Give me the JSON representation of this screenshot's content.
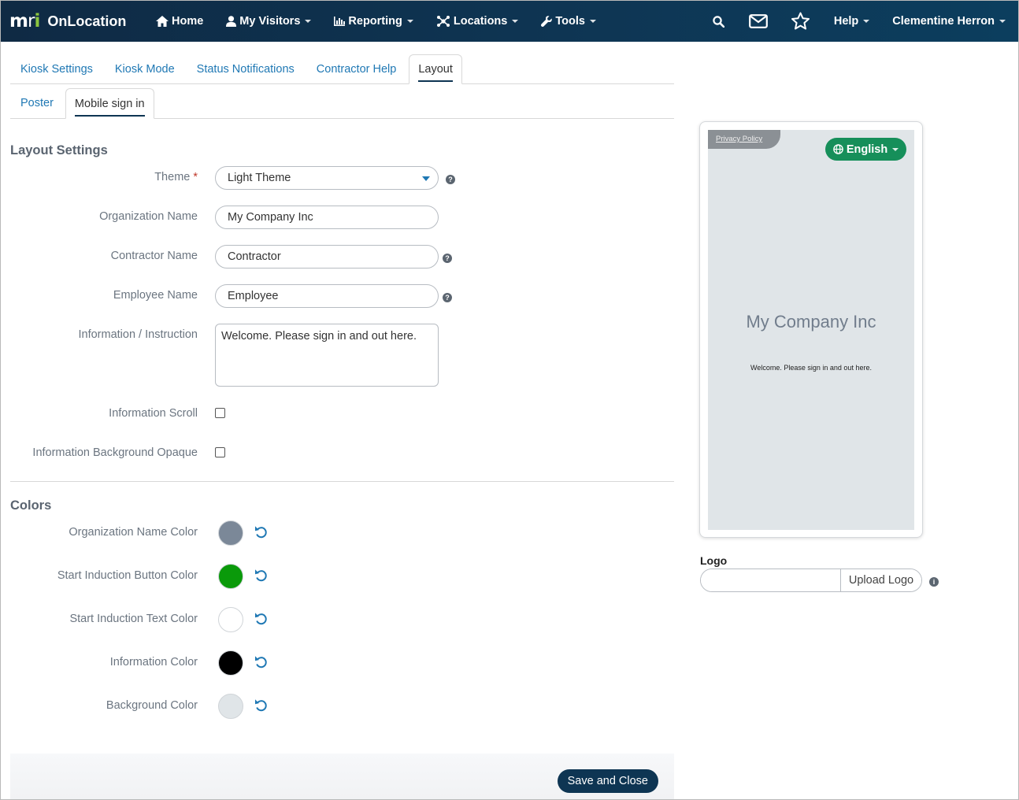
{
  "navbar": {
    "brand_logo": "mri",
    "brand_name": "OnLocation",
    "items": [
      {
        "label": "Home",
        "icon": "home-icon"
      },
      {
        "label": "My Visitors",
        "icon": "user-icon"
      },
      {
        "label": "Reporting",
        "icon": "chart-icon"
      },
      {
        "label": "Locations",
        "icon": "network-icon"
      },
      {
        "label": "Tools",
        "icon": "wrench-icon"
      }
    ],
    "help": "Help",
    "user": "Clementine Herron"
  },
  "tabs": [
    "Kiosk Settings",
    "Kiosk Mode",
    "Status Notifications",
    "Contractor Help",
    "Layout"
  ],
  "active_tab": "Layout",
  "subtabs": [
    "Poster",
    "Mobile sign in"
  ],
  "active_subtab": "Mobile sign in",
  "layout_settings": {
    "title": "Layout Settings",
    "theme_label": "Theme",
    "theme_required": "*",
    "theme_value": "Light Theme",
    "org_label": "Organization Name",
    "org_value": "My Company Inc",
    "contractor_label": "Contractor Name",
    "contractor_value": "Contractor",
    "employee_label": "Employee Name",
    "employee_value": "Employee",
    "info_label": "Information / Instruction",
    "info_value": "Welcome. Please sign in and out here.",
    "scroll_label": "Information Scroll",
    "opaque_label": "Information Background Opaque"
  },
  "colors": {
    "title": "Colors",
    "items": [
      {
        "label": "Organization Name Color",
        "color": "#7b8898"
      },
      {
        "label": "Start Induction Button Color",
        "color": "#0a9a0a"
      },
      {
        "label": "Start Induction Text Color",
        "color": "#ffffff"
      },
      {
        "label": "Information Color",
        "color": "#000000"
      },
      {
        "label": "Background Color",
        "color": "#e0e5e8"
      }
    ]
  },
  "footer": {
    "save_label": "Save and Close"
  },
  "preview": {
    "privacy_label": "Privacy Policy",
    "language": "English",
    "org_name": "My Company Inc",
    "info": "Welcome. Please sign in and out here."
  },
  "logo": {
    "label": "Logo",
    "upload_label": "Upload Logo"
  }
}
